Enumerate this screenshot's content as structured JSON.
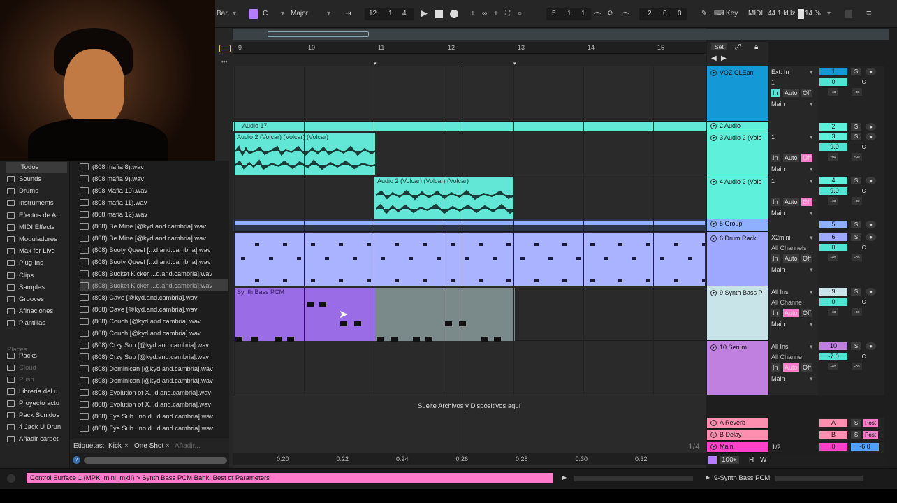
{
  "transport": {
    "scale_root": "C",
    "scale_name": "Major",
    "bar_label": "Bar",
    "position": [
      "12",
      "1",
      "4"
    ],
    "loop_start": [
      "5",
      "1",
      "1"
    ],
    "loop_length": [
      "2",
      "0",
      "0"
    ],
    "key_label": "Key",
    "midi_label": "MIDI",
    "sample_rate": "44.1 kHz",
    "cpu": "14 %"
  },
  "browser": {
    "categories_label": "Todos",
    "categories": [
      "Sounds",
      "Drums",
      "Instruments",
      "Efectos de Au",
      "MIDI Effects",
      "Moduladores",
      "Max for Live",
      "Plug-Ins",
      "Clips",
      "Samples",
      "Grooves",
      "Afinaciones",
      "Plantillas"
    ],
    "places_label": "Places",
    "places": [
      "Packs",
      "Cloud",
      "Push",
      "Librería del u",
      "Proyecto actu",
      "Pack Sonidos",
      "4 Jack U Drun",
      "Añadir carpet"
    ],
    "files": [
      "(808 mafia 8).wav",
      "(808 mafia 9).wav",
      "(808 Mafia 10).wav",
      "(808 mafia 11).wav",
      "(808 mafia 12).wav",
      "(808) Be Mine [@kyd.and.cambria].wav",
      "(808) Be Mine [@kyd.and.cambria].wav",
      "(808) Booty Queef [...d.and.cambria].wav",
      "(808) Booty Queef [...d.and.cambria].wav",
      "(808) Bucket Kicker ...d.and.cambria].wav",
      "(808) Bucket Kicker ...d.and.cambria].wav",
      "(808) Cave [@kyd.and.cambria].wav",
      "(808) Cave [@kyd.and.cambria].wav",
      "(808) Couch [@kyd.and.cambria].wav",
      "(808) Couch [@kyd.and.cambria].wav",
      "(808) Crzy Sub [@kyd.and.cambria].wav",
      "(808) Crzy Sub [@kyd.and.cambria].wav",
      "(808) Dominican [@kyd.and.cambria].wav",
      "(808) Dominican [@kyd.and.cambria].wav",
      "(808) Evolution of X...d.and.cambria].wav",
      "(808) Evolution of X...d.and.cambria].wav",
      "(808) Fye Sub.. no d...d.and.cambria].wav",
      "(808) Fye Sub.. no d...d.and.cambria].wav"
    ],
    "selected_file_index": 10,
    "tags_label": "Etiquetas:",
    "tags": [
      "Kick",
      "One Shot"
    ],
    "tag_add": "Añadir..."
  },
  "ruler": {
    "bars": [
      "9",
      "10",
      "11",
      "12",
      "13",
      "14",
      "15"
    ],
    "set_label": "Set"
  },
  "time_labels": [
    "0:20",
    "0:22",
    "0:24",
    "0:26",
    "0:28",
    "0:30",
    "0:32"
  ],
  "clips": {
    "audio17": "Audio 17",
    "clip_a": "Audio 2 (Volcar) (Volcar) (Volcar)",
    "clip_b": "Audio 2 (Volcar) (Volcar) (Volcar)",
    "synth": "Synth Bass PCM"
  },
  "drop_hint": "Suelte Archivos y Dispositivos aquí",
  "page_counter": "1/4",
  "tracks": [
    {
      "name": "VOZ CLEan",
      "color": "#1598d6",
      "input": "Ext. In",
      "channel": "1",
      "out": "Main",
      "num": "1",
      "vol": "0"
    },
    {
      "name": "2 Audio",
      "color": "#5ff0dc",
      "num": "2"
    },
    {
      "name": "3 Audio 2 (Volc",
      "color": "#5ff0dc",
      "input": "1",
      "out": "Main",
      "num": "3",
      "vol": "-9.0"
    },
    {
      "name": "4 Audio 2 (Volc",
      "color": "#5ff0dc",
      "input": "1",
      "out": "Main",
      "num": "4",
      "vol": "-9.0"
    },
    {
      "name": "5 Group",
      "color": "#8fb0ff",
      "num": "5"
    },
    {
      "name": "6 Drum Rack",
      "color": "#9fa8ff",
      "input": "X2mini",
      "channel": "All Channels",
      "out": "Main",
      "num": "6",
      "vol": "0"
    },
    {
      "name": "9 Synth Bass P",
      "color": "#c9e4e8",
      "input": "All Ins",
      "channel": "All Channe",
      "out": "Main",
      "num": "9",
      "vol": "0"
    },
    {
      "name": "10 Serum",
      "color": "#c080e0",
      "input": "All Ins",
      "channel": "All Channe",
      "out": "Main",
      "num": "10",
      "vol": "-7.0"
    }
  ],
  "returns": [
    {
      "name": "A Reverb",
      "num": "A",
      "color": "#ff8fb0"
    },
    {
      "name": "B Delay",
      "num": "B",
      "color": "#ff8fb0"
    },
    {
      "name": "Main",
      "num": "0",
      "vol": "-6.0",
      "color": "#ff40c8",
      "ratio": "1/2"
    }
  ],
  "labels": {
    "in": "In",
    "auto": "Auto",
    "off": "Off",
    "solo": "S",
    "c": "C",
    "post": "Post",
    "inf": "-∞",
    "h": "H",
    "w": "W",
    "zoom": "100x"
  },
  "status": {
    "message": "Control Surface 1 (MPK_mini_mkII) > Synth Bass PCM Bank: Best of Parameters",
    "track": "9-Synth Bass PCM"
  }
}
